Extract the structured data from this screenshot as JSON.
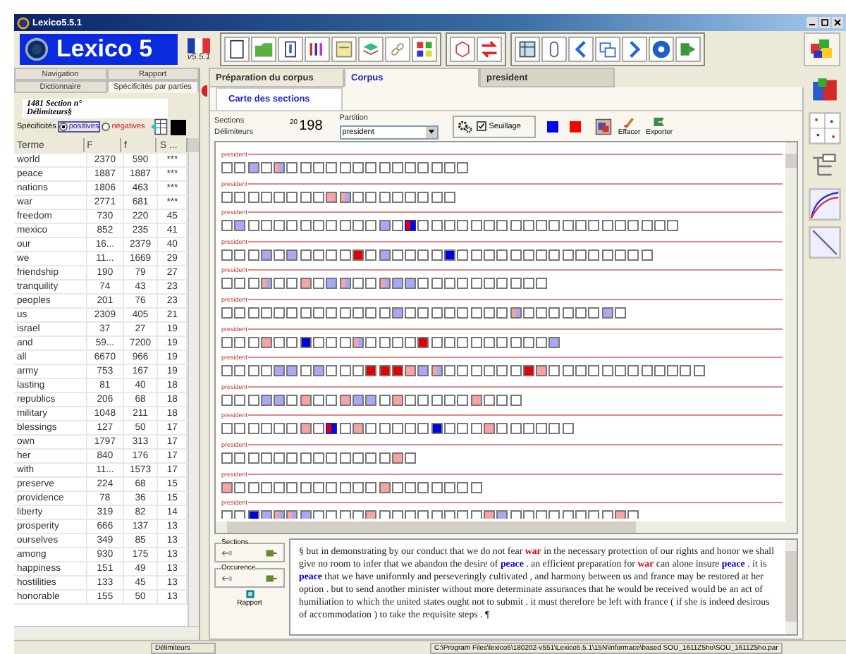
{
  "window": {
    "title": "Lexico5.5.1"
  },
  "logo": {
    "text": "Lexico 5",
    "version": "v5.5.1"
  },
  "left_panel": {
    "tabs_row1": [
      {
        "label": "Navigation",
        "selected": false
      },
      {
        "label": "Rapport",
        "selected": false
      }
    ],
    "tabs_row2": [
      {
        "label": "Dictionnaire",
        "selected": false
      },
      {
        "label": "Spécificités par parties",
        "selected": true
      }
    ],
    "section_title": "1481 Section n°",
    "section_subtitle": "Délimiteurs§",
    "specificites": {
      "label": "Spécificités",
      "options": [
        {
          "label": "positives",
          "selected": true
        },
        {
          "label": "négatives",
          "selected": false
        }
      ]
    },
    "table": {
      "columns": [
        "Terme",
        "F",
        "f",
        "S ..."
      ],
      "rows": [
        [
          "world",
          "2370",
          "590",
          "***"
        ],
        [
          "peace",
          "1887",
          "1887",
          "***"
        ],
        [
          "nations",
          "1806",
          "463",
          "***"
        ],
        [
          "war",
          "2771",
          "681",
          "***"
        ],
        [
          "freedom",
          "730",
          "220",
          "45"
        ],
        [
          "mexico",
          "852",
          "235",
          "41"
        ],
        [
          "our",
          "16...",
          "2379",
          "40"
        ],
        [
          "we",
          "11...",
          "1669",
          "29"
        ],
        [
          "friendship",
          "190",
          "79",
          "27"
        ],
        [
          "tranquility",
          "74",
          "43",
          "23"
        ],
        [
          "peoples",
          "201",
          "76",
          "23"
        ],
        [
          "us",
          "2309",
          "405",
          "21"
        ],
        [
          "israel",
          "37",
          "27",
          "19"
        ],
        [
          "and",
          "59...",
          "7200",
          "19"
        ],
        [
          "all",
          "6670",
          "966",
          "19"
        ],
        [
          "army",
          "753",
          "167",
          "19"
        ],
        [
          "lasting",
          "81",
          "40",
          "18"
        ],
        [
          "republics",
          "206",
          "68",
          "18"
        ],
        [
          "military",
          "1048",
          "211",
          "18"
        ],
        [
          "blessings",
          "127",
          "50",
          "17"
        ],
        [
          "own",
          "1797",
          "313",
          "17"
        ],
        [
          "her",
          "840",
          "176",
          "17"
        ],
        [
          "with",
          "11...",
          "1573",
          "17"
        ],
        [
          "preserve",
          "224",
          "68",
          "15"
        ],
        [
          "providence",
          "78",
          "36",
          "15"
        ],
        [
          "liberty",
          "319",
          "82",
          "14"
        ],
        [
          "prosperity",
          "666",
          "137",
          "13"
        ],
        [
          "ourselves",
          "349",
          "85",
          "13"
        ],
        [
          "among",
          "930",
          "175",
          "13"
        ],
        [
          "happiness",
          "151",
          "49",
          "13"
        ],
        [
          "hostilities",
          "133",
          "45",
          "13"
        ],
        [
          "honorable",
          "155",
          "50",
          "13"
        ]
      ]
    }
  },
  "tabs": [
    {
      "label": "Préparation du corpus",
      "selected": false
    },
    {
      "label": "Corpus",
      "selected": true
    },
    {
      "label": "president",
      "selected": false
    }
  ],
  "subtabs": [
    {
      "label": "Carte des sections",
      "selected": true
    }
  ],
  "controls": {
    "sections_label": "Sections",
    "sections_small": "20",
    "sections_count": "198",
    "delimiters_label": "Délimiteurs",
    "partition_label": "Partition",
    "partition_value": "president",
    "threshold": {
      "label": "Seuillage",
      "checked": true
    },
    "swatches": [
      {
        "color": "#0000ff"
      },
      {
        "color": "#ff0000"
      }
    ],
    "buttons": [
      "Effacer",
      "Exporter"
    ]
  },
  "section_map": {
    "rows": [
      {
        "label": "president",
        "cells": [
          {
            "kind": "empty"
          },
          {
            "kind": "empty"
          },
          {
            "kind": "blue"
          },
          {
            "kind": "empty"
          },
          {
            "kind": "mixed"
          },
          {
            "kind": "empty"
          },
          {
            "kind": "empty"
          },
          {
            "kind": "empty"
          },
          {
            "kind": "empty"
          },
          {
            "kind": "empty"
          },
          {
            "kind": "empty"
          },
          {
            "kind": "empty"
          },
          {
            "kind": "empty"
          },
          {
            "kind": "empty"
          },
          {
            "kind": "empty"
          },
          {
            "kind": "empty"
          },
          {
            "kind": "empty"
          },
          {
            "kind": "empty"
          },
          {
            "kind": "empty"
          }
        ]
      },
      {
        "label": "president",
        "cells": [
          {
            "kind": "empty"
          },
          {
            "kind": "empty"
          },
          {
            "kind": "empty"
          },
          {
            "kind": "empty"
          },
          {
            "kind": "empty"
          },
          {
            "kind": "empty"
          },
          {
            "kind": "empty"
          },
          {
            "kind": "empty"
          },
          {
            "kind": "pink"
          },
          {
            "kind": "mixed"
          },
          {
            "kind": "empty"
          },
          {
            "kind": "empty"
          },
          {
            "kind": "empty"
          },
          {
            "kind": "empty"
          },
          {
            "kind": "empty"
          },
          {
            "kind": "empty"
          },
          {
            "kind": "empty"
          },
          {
            "kind": "empty"
          }
        ]
      },
      {
        "label": "president",
        "cells": [
          {
            "kind": "empty"
          },
          {
            "kind": "blue"
          },
          {
            "kind": "empty"
          },
          {
            "kind": "empty"
          },
          {
            "kind": "empty"
          },
          {
            "kind": "empty"
          },
          {
            "kind": "empty"
          },
          {
            "kind": "empty"
          },
          {
            "kind": "empty"
          },
          {
            "kind": "empty"
          },
          {
            "kind": "empty"
          },
          {
            "kind": "empty"
          },
          {
            "kind": "blue"
          },
          {
            "kind": "empty"
          },
          {
            "kind": "split"
          },
          {
            "kind": "empty"
          },
          {
            "kind": "empty"
          },
          {
            "kind": "empty"
          },
          {
            "kind": "empty"
          },
          {
            "kind": "empty"
          },
          {
            "kind": "empty"
          },
          {
            "kind": "empty"
          },
          {
            "kind": "empty"
          },
          {
            "kind": "empty"
          },
          {
            "kind": "empty"
          },
          {
            "kind": "empty"
          },
          {
            "kind": "empty"
          },
          {
            "kind": "empty"
          },
          {
            "kind": "empty"
          },
          {
            "kind": "empty"
          },
          {
            "kind": "empty"
          },
          {
            "kind": "empty"
          },
          {
            "kind": "empty"
          },
          {
            "kind": "empty"
          },
          {
            "kind": "empty"
          }
        ]
      },
      {
        "label": "president",
        "cells": [
          {
            "kind": "empty"
          },
          {
            "kind": "empty"
          },
          {
            "kind": "empty"
          },
          {
            "kind": "blue"
          },
          {
            "kind": "empty"
          },
          {
            "kind": "blue"
          },
          {
            "kind": "empty"
          },
          {
            "kind": "empty"
          },
          {
            "kind": "empty"
          },
          {
            "kind": "empty"
          },
          {
            "kind": "red"
          },
          {
            "kind": "empty"
          },
          {
            "kind": "blue"
          },
          {
            "kind": "empty"
          },
          {
            "kind": "empty"
          },
          {
            "kind": "empty"
          },
          {
            "kind": "empty"
          },
          {
            "kind": "navy"
          },
          {
            "kind": "empty"
          },
          {
            "kind": "empty"
          },
          {
            "kind": "empty"
          },
          {
            "kind": "empty"
          },
          {
            "kind": "empty"
          },
          {
            "kind": "empty"
          },
          {
            "kind": "empty"
          },
          {
            "kind": "empty"
          },
          {
            "kind": "empty"
          },
          {
            "kind": "empty"
          },
          {
            "kind": "empty"
          },
          {
            "kind": "empty"
          },
          {
            "kind": "empty"
          },
          {
            "kind": "empty"
          },
          {
            "kind": "empty"
          }
        ]
      },
      {
        "label": "president",
        "cells": [
          {
            "kind": "empty"
          },
          {
            "kind": "empty"
          },
          {
            "kind": "empty"
          },
          {
            "kind": "mixed"
          },
          {
            "kind": "empty"
          },
          {
            "kind": "empty"
          },
          {
            "kind": "pink"
          },
          {
            "kind": "empty"
          },
          {
            "kind": "blue"
          },
          {
            "kind": "mixed"
          },
          {
            "kind": "empty"
          },
          {
            "kind": "empty"
          },
          {
            "kind": "mixed"
          },
          {
            "kind": "blue"
          },
          {
            "kind": "blue"
          },
          {
            "kind": "empty"
          },
          {
            "kind": "empty"
          },
          {
            "kind": "empty"
          },
          {
            "kind": "empty"
          },
          {
            "kind": "empty"
          },
          {
            "kind": "empty"
          },
          {
            "kind": "empty"
          },
          {
            "kind": "empty"
          },
          {
            "kind": "empty"
          },
          {
            "kind": "empty"
          }
        ]
      },
      {
        "label": "president",
        "cells": [
          {
            "kind": "empty"
          },
          {
            "kind": "empty"
          },
          {
            "kind": "empty"
          },
          {
            "kind": "empty"
          },
          {
            "kind": "empty"
          },
          {
            "kind": "empty"
          },
          {
            "kind": "empty"
          },
          {
            "kind": "empty"
          },
          {
            "kind": "empty"
          },
          {
            "kind": "empty"
          },
          {
            "kind": "empty"
          },
          {
            "kind": "empty"
          },
          {
            "kind": "empty"
          },
          {
            "kind": "blue"
          },
          {
            "kind": "empty"
          },
          {
            "kind": "empty"
          },
          {
            "kind": "empty"
          },
          {
            "kind": "empty"
          },
          {
            "kind": "empty"
          },
          {
            "kind": "empty"
          },
          {
            "kind": "empty"
          },
          {
            "kind": "empty"
          },
          {
            "kind": "mixed"
          },
          {
            "kind": "empty"
          },
          {
            "kind": "empty"
          },
          {
            "kind": "empty"
          },
          {
            "kind": "empty"
          },
          {
            "kind": "empty"
          },
          {
            "kind": "empty"
          },
          {
            "kind": "blue"
          },
          {
            "kind": "empty"
          }
        ]
      },
      {
        "label": "president",
        "cells": [
          {
            "kind": "empty"
          },
          {
            "kind": "empty"
          },
          {
            "kind": "empty"
          },
          {
            "kind": "pink"
          },
          {
            "kind": "empty"
          },
          {
            "kind": "empty"
          },
          {
            "kind": "navy"
          },
          {
            "kind": "empty"
          },
          {
            "kind": "empty"
          },
          {
            "kind": "empty"
          },
          {
            "kind": "mixed"
          },
          {
            "kind": "empty"
          },
          {
            "kind": "empty"
          },
          {
            "kind": "empty"
          },
          {
            "kind": "empty"
          },
          {
            "kind": "red"
          },
          {
            "kind": "empty"
          },
          {
            "kind": "empty"
          },
          {
            "kind": "empty"
          },
          {
            "kind": "empty"
          },
          {
            "kind": "empty"
          },
          {
            "kind": "empty"
          },
          {
            "kind": "empty"
          },
          {
            "kind": "empty"
          },
          {
            "kind": "empty"
          },
          {
            "kind": "blue"
          }
        ]
      },
      {
        "label": "president",
        "cells": [
          {
            "kind": "empty"
          },
          {
            "kind": "empty"
          },
          {
            "kind": "empty"
          },
          {
            "kind": "empty"
          },
          {
            "kind": "blue"
          },
          {
            "kind": "blue"
          },
          {
            "kind": "empty"
          },
          {
            "kind": "blue"
          },
          {
            "kind": "empty"
          },
          {
            "kind": "empty"
          },
          {
            "kind": "empty"
          },
          {
            "kind": "red"
          },
          {
            "kind": "red"
          },
          {
            "kind": "red"
          },
          {
            "kind": "pink"
          },
          {
            "kind": "blue"
          },
          {
            "kind": "mixed"
          },
          {
            "kind": "empty"
          },
          {
            "kind": "empty"
          },
          {
            "kind": "empty"
          },
          {
            "kind": "empty"
          },
          {
            "kind": "empty"
          },
          {
            "kind": "empty"
          },
          {
            "kind": "red"
          },
          {
            "kind": "pink"
          },
          {
            "kind": "empty"
          },
          {
            "kind": "empty"
          },
          {
            "kind": "empty"
          },
          {
            "kind": "empty"
          },
          {
            "kind": "empty"
          },
          {
            "kind": "empty"
          },
          {
            "kind": "empty"
          },
          {
            "kind": "empty"
          },
          {
            "kind": "empty"
          },
          {
            "kind": "empty"
          },
          {
            "kind": "empty"
          },
          {
            "kind": "empty"
          }
        ]
      },
      {
        "label": "president",
        "cells": [
          {
            "kind": "empty"
          },
          {
            "kind": "empty"
          },
          {
            "kind": "empty"
          },
          {
            "kind": "blue"
          },
          {
            "kind": "blue"
          },
          {
            "kind": "empty"
          },
          {
            "kind": "pink"
          },
          {
            "kind": "empty"
          },
          {
            "kind": "empty"
          },
          {
            "kind": "pink"
          },
          {
            "kind": "blue"
          },
          {
            "kind": "blue"
          },
          {
            "kind": "empty"
          },
          {
            "kind": "pink"
          },
          {
            "kind": "empty"
          },
          {
            "kind": "empty"
          },
          {
            "kind": "empty"
          },
          {
            "kind": "empty"
          },
          {
            "kind": "empty"
          },
          {
            "kind": "pink"
          },
          {
            "kind": "empty"
          },
          {
            "kind": "empty"
          },
          {
            "kind": "empty"
          }
        ]
      },
      {
        "label": "president",
        "cells": [
          {
            "kind": "empty"
          },
          {
            "kind": "empty"
          },
          {
            "kind": "empty"
          },
          {
            "kind": "empty"
          },
          {
            "kind": "empty"
          },
          {
            "kind": "empty"
          },
          {
            "kind": "pink"
          },
          {
            "kind": "empty"
          },
          {
            "kind": "split"
          },
          {
            "kind": "empty"
          },
          {
            "kind": "pink"
          },
          {
            "kind": "empty"
          },
          {
            "kind": "empty"
          },
          {
            "kind": "empty"
          },
          {
            "kind": "empty"
          },
          {
            "kind": "empty"
          },
          {
            "kind": "navy"
          },
          {
            "kind": "empty"
          },
          {
            "kind": "empty"
          },
          {
            "kind": "empty"
          },
          {
            "kind": "pink"
          },
          {
            "kind": "empty"
          },
          {
            "kind": "empty"
          },
          {
            "kind": "empty"
          },
          {
            "kind": "empty"
          },
          {
            "kind": "empty"
          },
          {
            "kind": "empty"
          }
        ]
      },
      {
        "label": "president",
        "cells": [
          {
            "kind": "empty"
          },
          {
            "kind": "empty"
          },
          {
            "kind": "empty"
          },
          {
            "kind": "empty"
          },
          {
            "kind": "empty"
          },
          {
            "kind": "empty"
          },
          {
            "kind": "empty"
          },
          {
            "kind": "empty"
          },
          {
            "kind": "empty"
          },
          {
            "kind": "empty"
          },
          {
            "kind": "empty"
          },
          {
            "kind": "empty"
          },
          {
            "kind": "empty"
          },
          {
            "kind": "pink"
          },
          {
            "kind": "empty"
          }
        ]
      },
      {
        "label": "president",
        "cells": [
          {
            "kind": "pink"
          },
          {
            "kind": "empty"
          },
          {
            "kind": "empty"
          },
          {
            "kind": "empty"
          },
          {
            "kind": "empty"
          },
          {
            "kind": "empty"
          },
          {
            "kind": "empty"
          },
          {
            "kind": "empty"
          },
          {
            "kind": "empty"
          },
          {
            "kind": "empty"
          },
          {
            "kind": "empty"
          },
          {
            "kind": "empty"
          },
          {
            "kind": "pink"
          },
          {
            "kind": "empty"
          },
          {
            "kind": "empty"
          },
          {
            "kind": "empty"
          },
          {
            "kind": "empty"
          },
          {
            "kind": "empty"
          },
          {
            "kind": "empty"
          },
          {
            "kind": "empty"
          }
        ]
      },
      {
        "label": "president",
        "cells": [
          {
            "kind": "empty"
          },
          {
            "kind": "empty"
          },
          {
            "kind": "navy"
          },
          {
            "kind": "blue"
          },
          {
            "kind": "mixed"
          },
          {
            "kind": "mixed"
          },
          {
            "kind": "blue"
          },
          {
            "kind": "empty"
          },
          {
            "kind": "empty"
          },
          {
            "kind": "empty"
          },
          {
            "kind": "empty"
          },
          {
            "kind": "pink"
          },
          {
            "kind": "empty"
          },
          {
            "kind": "empty"
          },
          {
            "kind": "empty"
          },
          {
            "kind": "empty"
          },
          {
            "kind": "empty"
          },
          {
            "kind": "empty"
          },
          {
            "kind": "empty"
          },
          {
            "kind": "empty"
          },
          {
            "kind": "pink"
          },
          {
            "kind": "blue"
          },
          {
            "kind": "empty"
          },
          {
            "kind": "empty"
          },
          {
            "kind": "empty"
          },
          {
            "kind": "empty"
          },
          {
            "kind": "empty"
          },
          {
            "kind": "empty"
          },
          {
            "kind": "empty"
          },
          {
            "kind": "empty"
          },
          {
            "kind": "pink"
          },
          {
            "kind": "empty"
          }
        ]
      }
    ]
  },
  "bottom": {
    "sections_label": "Sections",
    "occurrence_label": "Occurence",
    "report_label": "Rapport",
    "text": [
      {
        "text": "§ but in demonstrating by our conduct that we do not fear "
      },
      {
        "text": "war",
        "color": "#dd0000"
      },
      {
        "text": " in the necessary protection of our rights and honor we shall give no room to infer that we abandon the desire of "
      },
      {
        "text": "peace",
        "color": "#0000cc"
      },
      {
        "text": " . an efficient preparation for "
      },
      {
        "text": "war",
        "color": "#dd0000"
      },
      {
        "text": " can alone insure "
      },
      {
        "text": "peace",
        "color": "#0000cc"
      },
      {
        "text": " . it is "
      },
      {
        "text": "peace",
        "color": "#0000cc"
      },
      {
        "text": " that we have uniformly and perseveringly cultivated , and harmony between us and france may be restored at her option . but to send another minister without more determinate assurances that he would be received would be an act of humiliation to which the united states ought not to submit . it must therefore be left with france ( if she is indeed desirous of accommodation ) to take the requisite steps . ¶"
      }
    ]
  },
  "status_bar": {
    "left": "Délimiteurs",
    "path": "C:\\Program Files\\lexico5\\180202-v551\\Lexico5.5.1\\15N\\informace\\based SOU_1611Z5ho\\SOU_1611Z5ho.par"
  }
}
